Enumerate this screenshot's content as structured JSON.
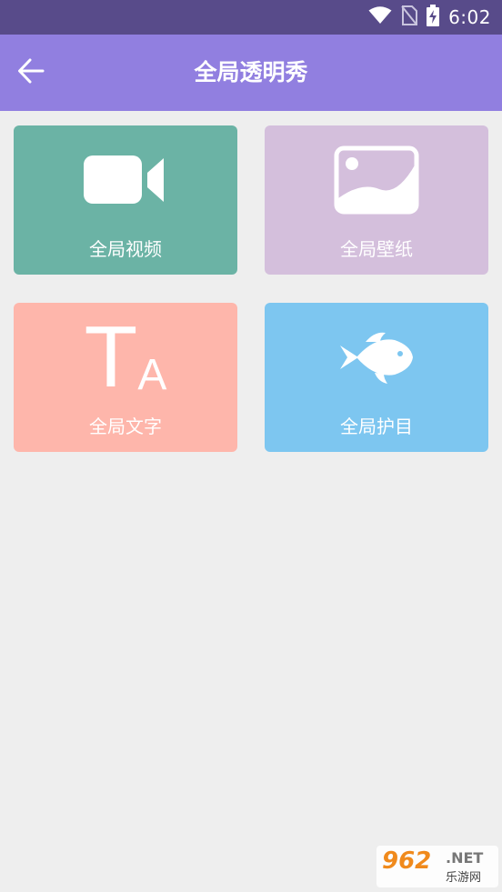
{
  "status_bar": {
    "time": "6:02",
    "icons": [
      "wifi-icon",
      "no-sim-icon",
      "battery-charging-icon"
    ]
  },
  "app_bar": {
    "title": "全局透明秀",
    "back_icon": "arrow-left-icon"
  },
  "cards": [
    {
      "label": "全局视频",
      "icon": "video-camera-icon",
      "color": "#6bb3a5"
    },
    {
      "label": "全局壁纸",
      "icon": "image-icon",
      "color": "#d4bfdc"
    },
    {
      "label": "全局文字",
      "icon": "text-icon",
      "color": "#feb6ab"
    },
    {
      "label": "全局护目",
      "icon": "fish-icon",
      "color": "#7dc6f0"
    }
  ],
  "text_icon_letters": {
    "big": "T",
    "small": "A"
  },
  "watermark": {
    "logo": "962",
    "suffix": ".NET",
    "subtitle": "乐游网"
  },
  "colors": {
    "status_bar": "#584b8a",
    "app_bar": "#917fe0",
    "background": "#eeeeee"
  }
}
